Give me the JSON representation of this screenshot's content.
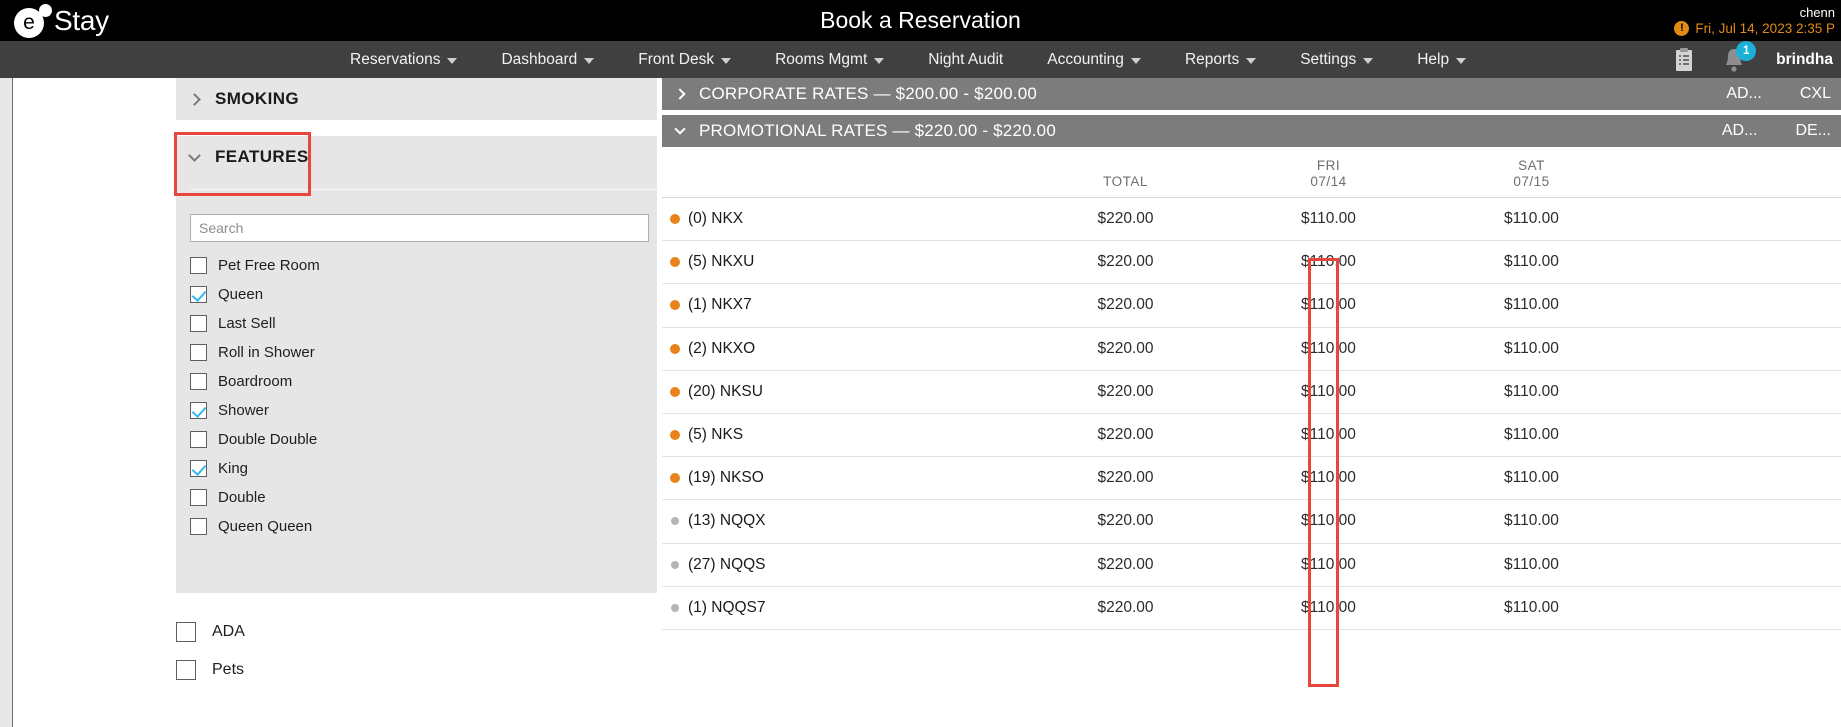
{
  "app": {
    "logo_letter": "e",
    "logo_text": "Stay",
    "page_title": "Book a Reservation",
    "property": "chenn",
    "datetime": "Fri, Jul 14, 2023 2:35 P",
    "warning_icon": "exclamation-icon",
    "username": "brindha",
    "notification_count": "1"
  },
  "nav": {
    "items": [
      {
        "label": "Reservations",
        "has_caret": true
      },
      {
        "label": "Dashboard",
        "has_caret": true
      },
      {
        "label": "Front Desk",
        "has_caret": true
      },
      {
        "label": "Rooms Mgmt",
        "has_caret": true
      },
      {
        "label": "Night Audit",
        "has_caret": false
      },
      {
        "label": "Accounting",
        "has_caret": true
      },
      {
        "label": "Reports",
        "has_caret": true
      },
      {
        "label": "Settings",
        "has_caret": true
      },
      {
        "label": "Help",
        "has_caret": true
      }
    ],
    "icons": [
      "clipboard-icon",
      "bell-icon"
    ]
  },
  "sidebar": {
    "sections": [
      {
        "title": "SMOKING",
        "expanded": false
      },
      {
        "title": "FEATURES",
        "expanded": true,
        "highlighted": true
      }
    ],
    "search": {
      "placeholder": "Search",
      "value": ""
    },
    "features": [
      {
        "label": "Pet Free Room",
        "checked": false
      },
      {
        "label": "Queen",
        "checked": true
      },
      {
        "label": "Last Sell",
        "checked": false
      },
      {
        "label": "Roll in Shower",
        "checked": false
      },
      {
        "label": "Boardroom",
        "checked": false
      },
      {
        "label": "Shower",
        "checked": true
      },
      {
        "label": "Double Double",
        "checked": false
      },
      {
        "label": "King",
        "checked": true
      },
      {
        "label": "Double",
        "checked": false
      },
      {
        "label": "Queen Queen",
        "checked": false
      }
    ],
    "extras": [
      {
        "label": "ADA",
        "checked": false
      },
      {
        "label": "Pets",
        "checked": false
      }
    ]
  },
  "rates": {
    "bars": [
      {
        "title": "CORPORATE RATES — $200.00 - $200.00",
        "expanded": false,
        "actions": [
          "AD...",
          "CXL"
        ]
      },
      {
        "title": "PROMOTIONAL RATES — $220.00 - $220.00",
        "expanded": true,
        "actions": [
          "AD...",
          "DE..."
        ]
      }
    ],
    "columns": [
      {
        "label": "",
        "sub": ""
      },
      {
        "label": "TOTAL",
        "sub": ""
      },
      {
        "label": "FRI",
        "sub": "07/14"
      },
      {
        "label": "SAT",
        "sub": "07/15"
      }
    ],
    "rows": [
      {
        "code": "(0) NKX",
        "available": true,
        "total": "$220.00",
        "fri": "$110.00",
        "sat": "$110.00"
      },
      {
        "code": "(5) NKXU",
        "available": true,
        "total": "$220.00",
        "fri": "$110.00",
        "sat": "$110.00"
      },
      {
        "code": "(1) NKX7",
        "available": true,
        "total": "$220.00",
        "fri": "$110.00",
        "sat": "$110.00"
      },
      {
        "code": "(2) NKXO",
        "available": true,
        "total": "$220.00",
        "fri": "$110.00",
        "sat": "$110.00"
      },
      {
        "code": "(20) NKSU",
        "available": true,
        "total": "$220.00",
        "fri": "$110.00",
        "sat": "$110.00"
      },
      {
        "code": "(5) NKS",
        "available": true,
        "total": "$220.00",
        "fri": "$110.00",
        "sat": "$110.00"
      },
      {
        "code": "(19) NKSO",
        "available": true,
        "total": "$220.00",
        "fri": "$110.00",
        "sat": "$110.00"
      },
      {
        "code": "(13) NQQX",
        "available": false,
        "total": "$220.00",
        "fri": "$110.00",
        "sat": "$110.00"
      },
      {
        "code": "(27) NQQS",
        "available": false,
        "total": "$220.00",
        "fri": "$110.00",
        "sat": "$110.00"
      },
      {
        "code": "(1) NQQS7",
        "available": false,
        "total": "$220.00",
        "fri": "$110.00",
        "sat": "$110.00"
      }
    ]
  },
  "colors": {
    "accent_orange": "#e8821a",
    "highlight_red": "#e8453c",
    "badge_blue": "#1ab0d8",
    "checkbox_blue": "#35b9e6",
    "nav_bg": "#404040",
    "bar_gray": "#7c7c7c"
  }
}
